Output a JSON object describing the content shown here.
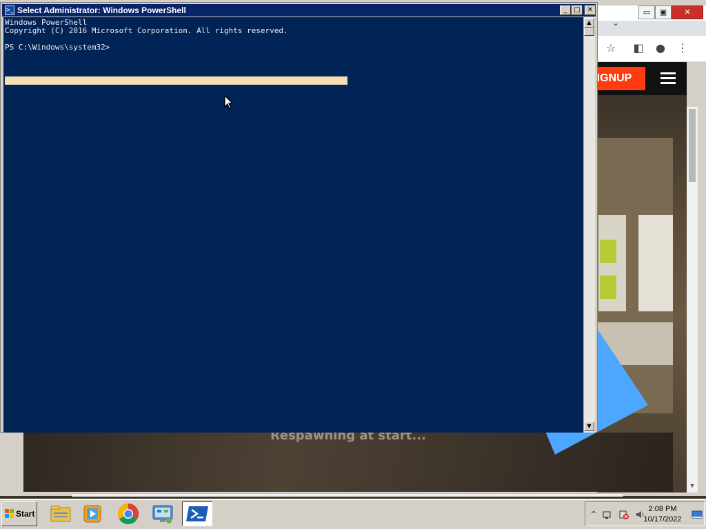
{
  "browser": {
    "tab_chevron": "⌄",
    "min_icon": "▭",
    "max_icon": "▣",
    "close_icon": "✕",
    "bookmark_icon": "☆",
    "sidepanel_icon": "◧",
    "profile_icon": "●",
    "menu_icon": "⋮",
    "signup_label": "SIGNUP",
    "respawn_text": "Respawning at start..."
  },
  "powershell": {
    "title": "Select Administrator: Windows PowerShell",
    "title_icon": ">_",
    "min_label": "_",
    "max_label": "□",
    "close_label": "✕",
    "lines": [
      "Windows PowerShell",
      "Copyright (C) 2016 Microsoft Corporation. All rights reserved.",
      "",
      "PS C:\\Windows\\system32>"
    ],
    "scroll_up": "▲",
    "scroll_down": "▼"
  },
  "taskbar": {
    "start_label": "Start",
    "pinned": [
      "file-explorer",
      "media-player",
      "chrome",
      "control-panel",
      "powershell"
    ],
    "tray": {
      "show_hidden": "^",
      "time": "2:08 PM",
      "date": "10/17/2022"
    }
  },
  "colors": {
    "console_bg": "#012456",
    "console_fg": "#eeedf0",
    "title_active": "#0a246a",
    "selection": "#f5deb3",
    "signup": "#ff3b10"
  }
}
